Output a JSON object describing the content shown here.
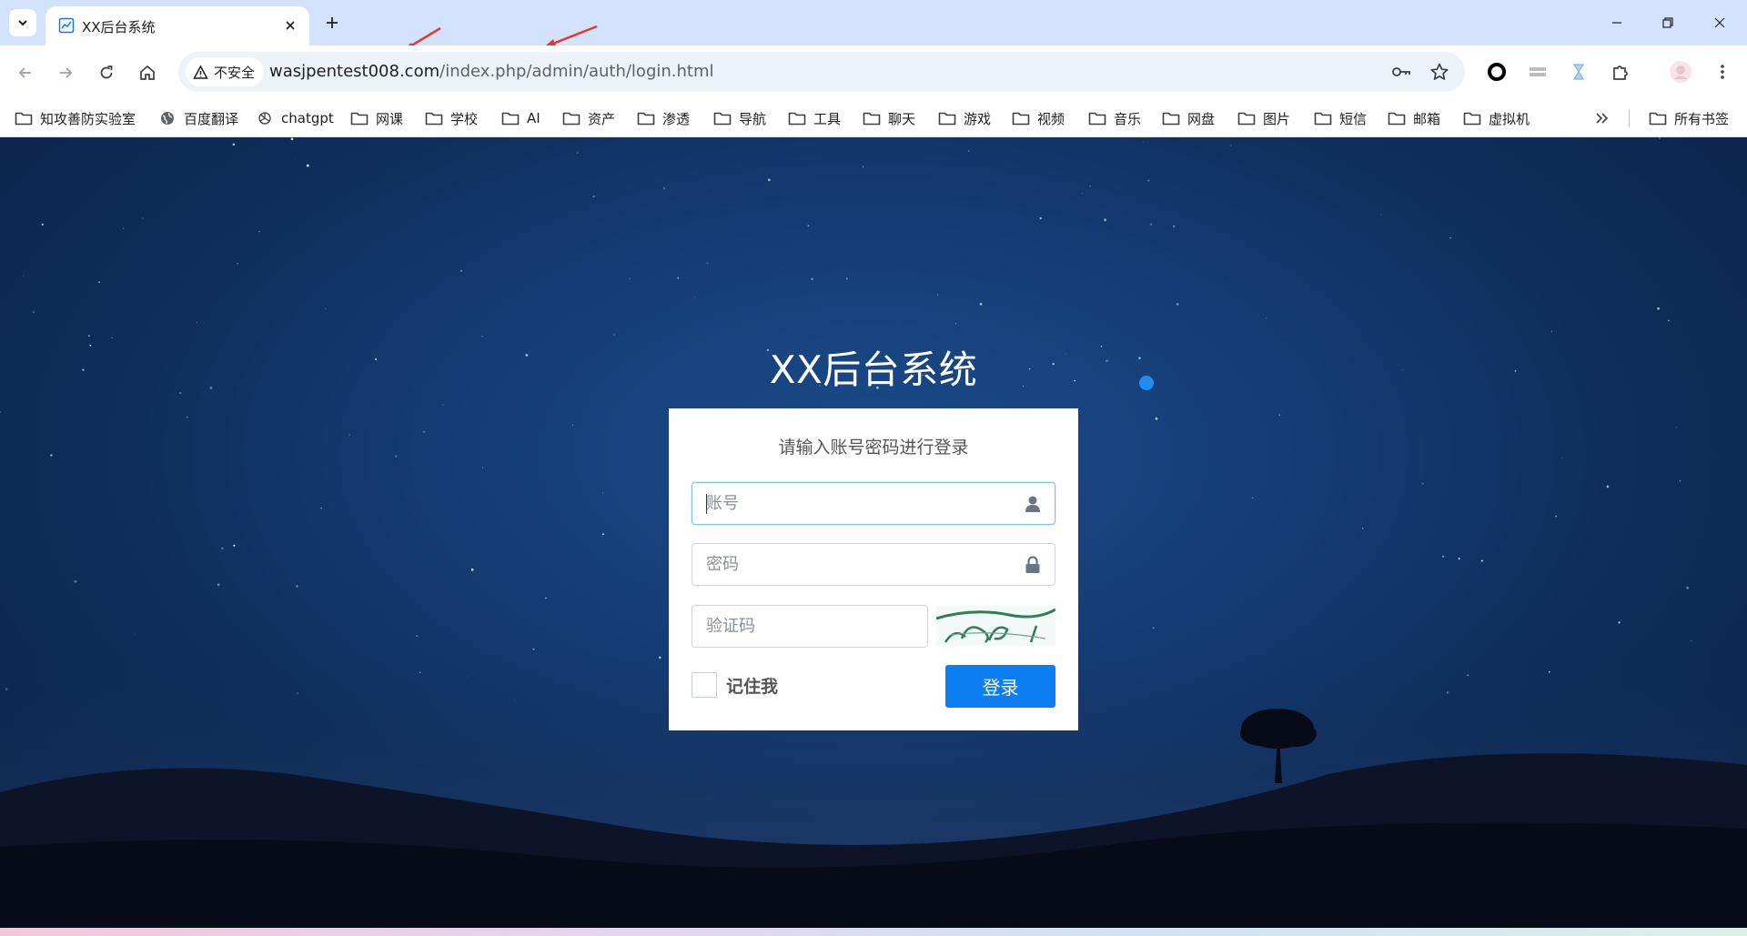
{
  "browser": {
    "tab": {
      "title": "XX后台系统"
    },
    "url": {
      "host": "wasjpentest008.com",
      "path": "/index.php/admin/auth/login.html"
    },
    "security_label": "不安全",
    "bookmarks": [
      {
        "label": "知攻善防实验室",
        "icon": "folder-icon"
      },
      {
        "label": "百度翻译",
        "icon": "globe-icon"
      },
      {
        "label": "chatgpt",
        "icon": "openai-icon"
      },
      {
        "label": "网课",
        "icon": "folder-icon"
      },
      {
        "label": "学校",
        "icon": "folder-icon"
      },
      {
        "label": "AI",
        "icon": "folder-icon"
      },
      {
        "label": "资产",
        "icon": "folder-icon"
      },
      {
        "label": "渗透",
        "icon": "folder-icon"
      },
      {
        "label": "导航",
        "icon": "folder-icon"
      },
      {
        "label": "工具",
        "icon": "folder-icon"
      },
      {
        "label": "聊天",
        "icon": "folder-icon"
      },
      {
        "label": "游戏",
        "icon": "folder-icon"
      },
      {
        "label": "视频",
        "icon": "folder-icon"
      },
      {
        "label": "音乐",
        "icon": "folder-icon"
      },
      {
        "label": "网盘",
        "icon": "folder-icon"
      },
      {
        "label": "图片",
        "icon": "folder-icon"
      },
      {
        "label": "短信",
        "icon": "folder-icon"
      },
      {
        "label": "邮箱",
        "icon": "folder-icon"
      },
      {
        "label": "虚拟机",
        "icon": "folder-icon"
      }
    ],
    "all_bookmarks": "所有书签"
  },
  "login": {
    "title": "XX后台系统",
    "subtitle": "请输入账号密码进行登录",
    "username": {
      "placeholder": "账号",
      "value": ""
    },
    "password": {
      "placeholder": "密码",
      "value": ""
    },
    "captcha": {
      "placeholder": "验证码",
      "value": ""
    },
    "remember_label": "记住我",
    "remember_checked": false,
    "submit_label": "登录"
  },
  "colors": {
    "primary_button": "#0d7ef2",
    "tabstrip": "#d3e3fd",
    "focus_border": "#80bdff"
  }
}
